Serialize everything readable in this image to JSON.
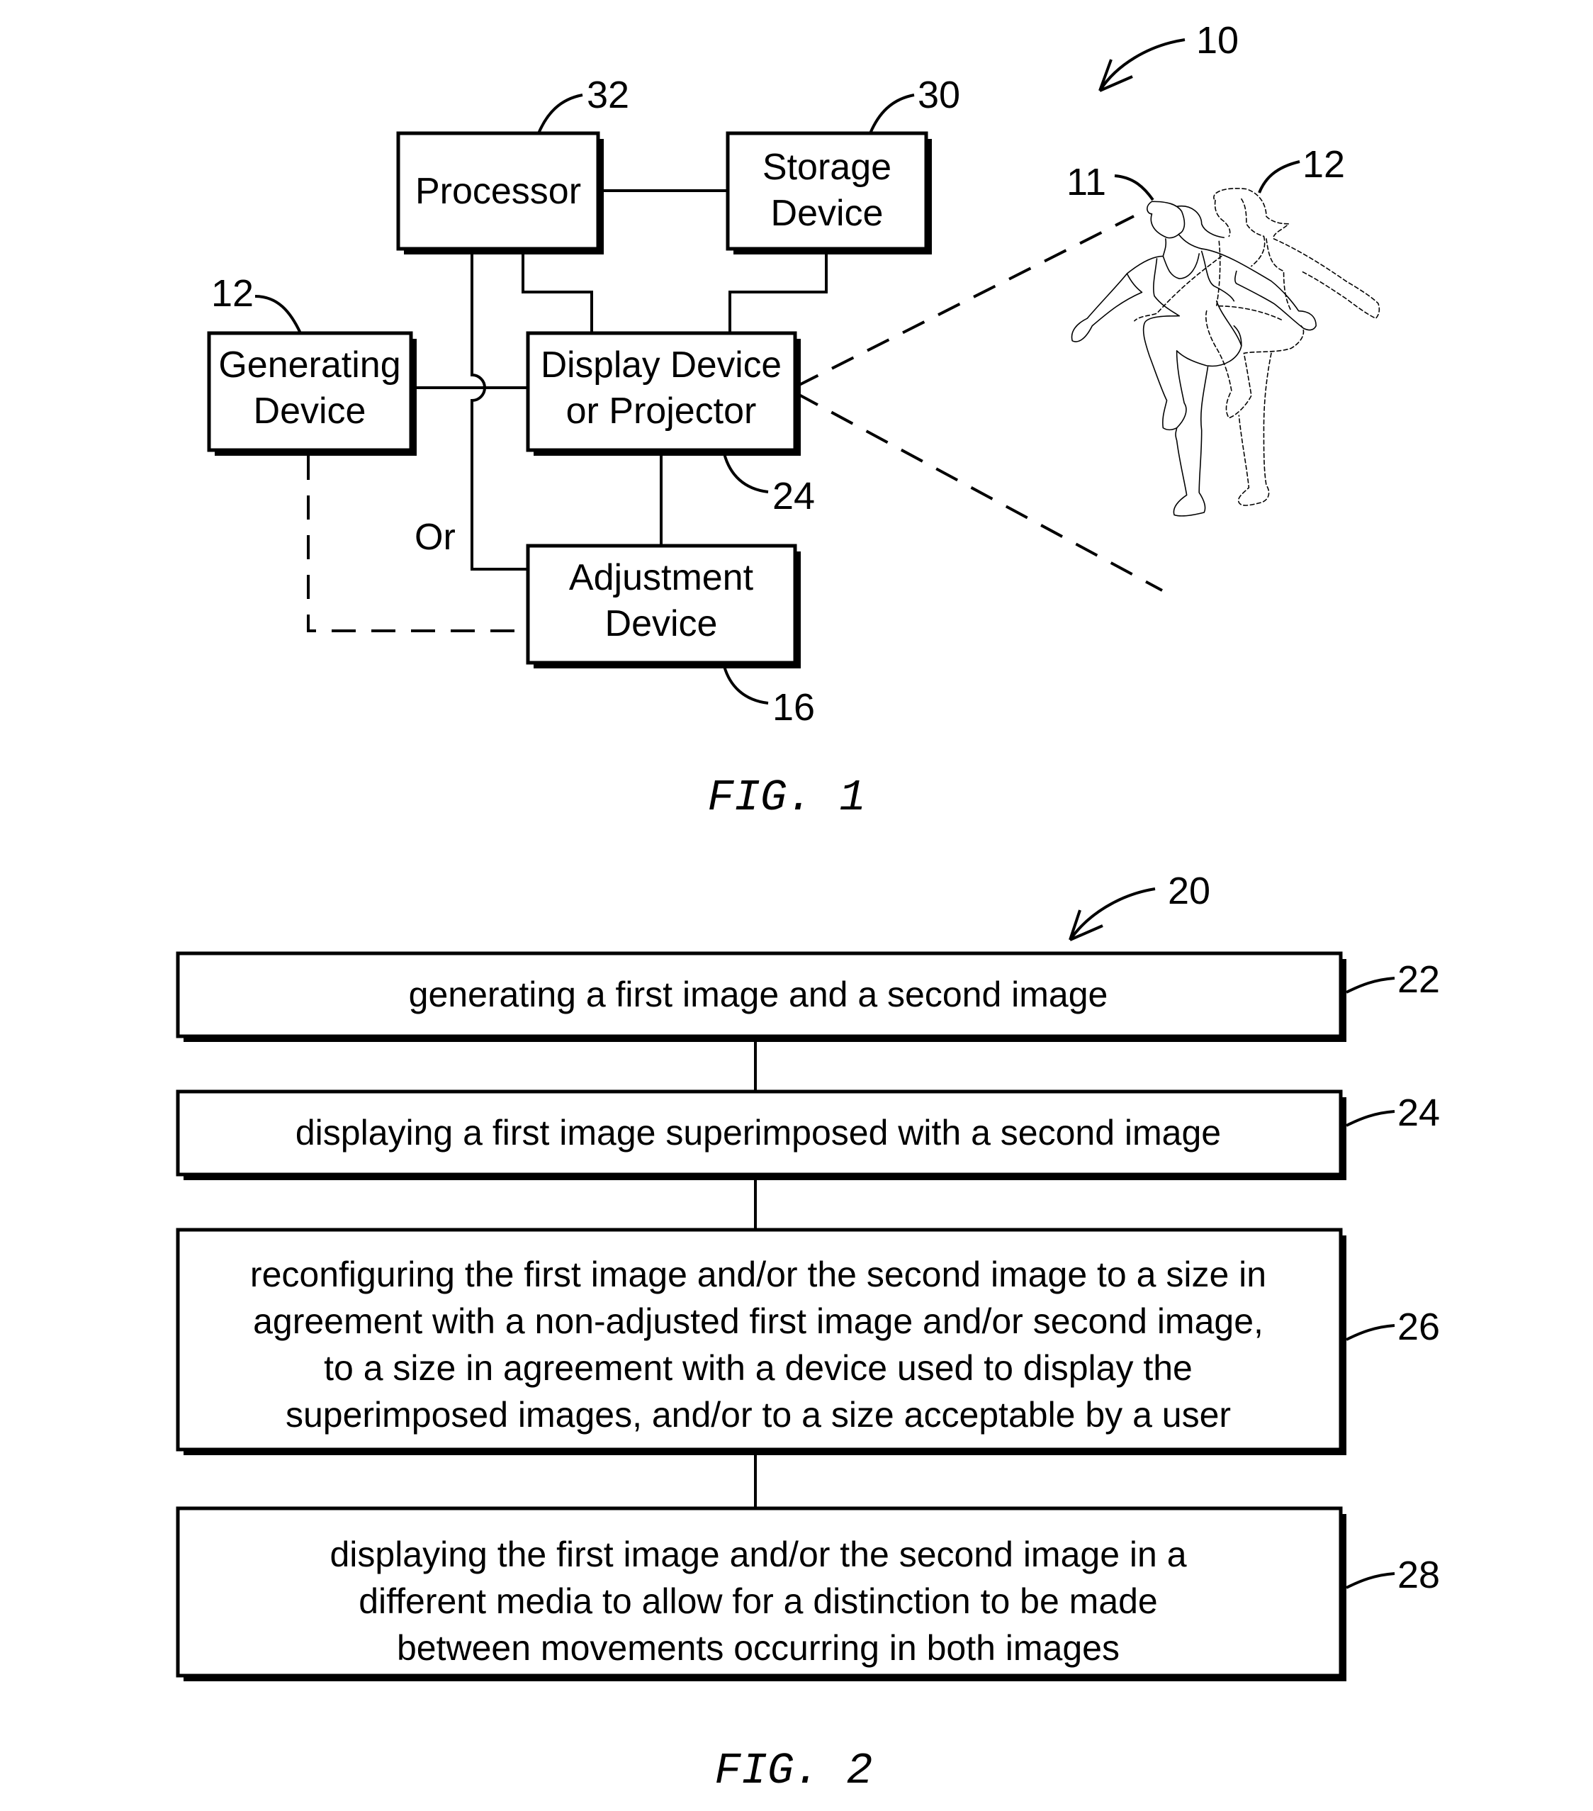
{
  "figure1": {
    "ref_number": "10",
    "caption": "FIG. 1",
    "blocks": {
      "processor": {
        "ref": "32",
        "lines": [
          "Processor"
        ]
      },
      "storage": {
        "ref": "30",
        "lines": [
          "Storage",
          "Device"
        ]
      },
      "generating": {
        "ref": "12",
        "lines": [
          "Generating",
          "Device"
        ]
      },
      "display": {
        "ref": "24",
        "lines": [
          "Display Device",
          "or Projector"
        ]
      },
      "adjustment": {
        "ref": "16",
        "lines": [
          "Adjustment",
          "Device"
        ]
      }
    },
    "or_label": "Or",
    "people": {
      "first_image_ref": "11",
      "second_image_ref": "12"
    }
  },
  "figure2": {
    "ref_number": "20",
    "caption": "FIG. 2",
    "steps": [
      {
        "ref": "22",
        "lines": [
          "generating a first image and a second image"
        ]
      },
      {
        "ref": "24",
        "lines": [
          "displaying a first image superimposed with a second image"
        ]
      },
      {
        "ref": "26",
        "lines": [
          "reconfiguring the first image and/or the second image to a size in",
          "agreement with a non-adjusted first image and/or second image,",
          "to a size in agreement with a device used to display the",
          "superimposed images, and/or to a size acceptable by a user"
        ]
      },
      {
        "ref": "28",
        "lines": [
          "displaying the first image and/or the second image in a",
          "different media to allow for a distinction to be made",
          "between movements occurring in both images"
        ]
      }
    ]
  }
}
